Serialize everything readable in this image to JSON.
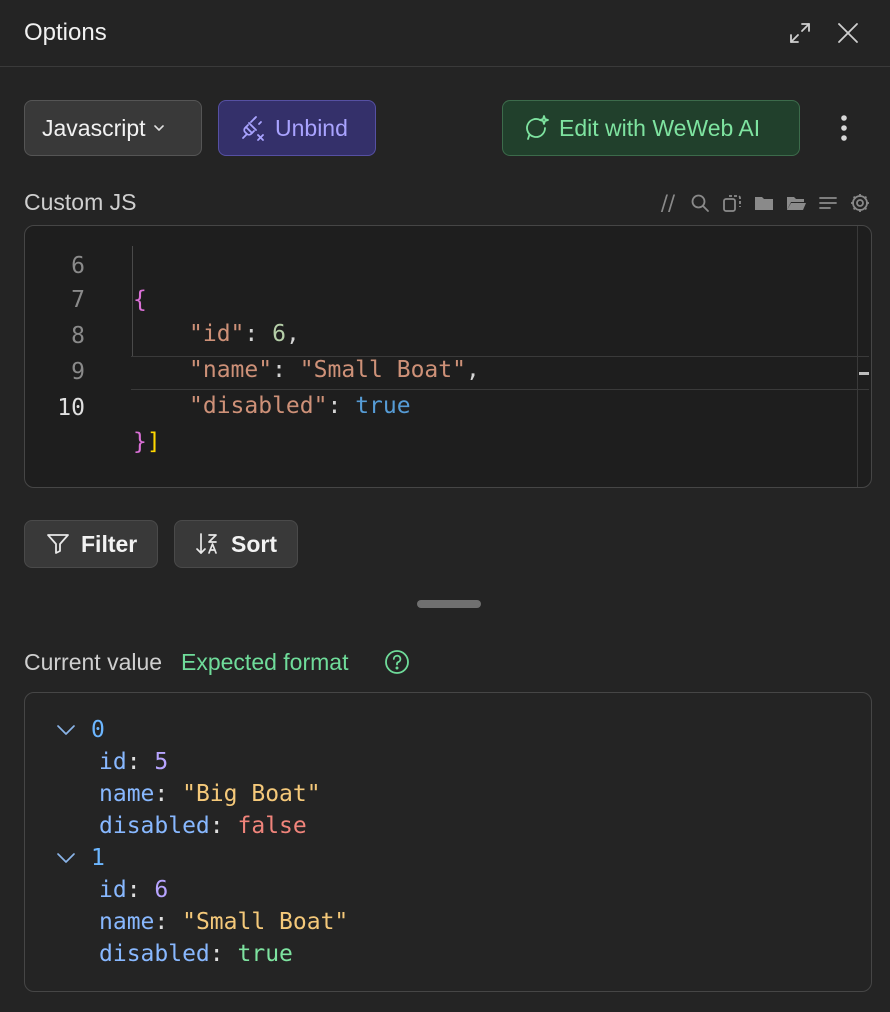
{
  "header": {
    "title": "Options",
    "icons": [
      "expand-icon",
      "close-icon"
    ]
  },
  "toolbar": {
    "language": "Javascript",
    "unbind_label": "Unbind",
    "ai_label": "Edit with WeWeb AI"
  },
  "custom_js": {
    "label": "Custom JS",
    "tools": [
      "comment-icon",
      "search-icon",
      "copy-icon",
      "folder-icon",
      "folder-open-icon",
      "format-icon",
      "settings-icon"
    ],
    "lines": [
      {
        "num": "6",
        "text": "{"
      },
      {
        "num": "7",
        "key": "\"id\"",
        "sep": ": ",
        "value": "6",
        "tail": ","
      },
      {
        "num": "8",
        "key": "\"name\"",
        "sep": ": ",
        "value": "\"Small Boat\"",
        "tail": ","
      },
      {
        "num": "9",
        "key": "\"disabled\"",
        "sep": ": ",
        "value": "true",
        "tail": ""
      },
      {
        "num": "10",
        "open": "}",
        "close": "]"
      }
    ]
  },
  "actions": {
    "filter_label": "Filter",
    "sort_label": "Sort"
  },
  "current_value": {
    "label": "Current value",
    "expected_label": "Expected format",
    "items": [
      {
        "index": "0",
        "id": "5",
        "name": "\"Big Boat\"",
        "disabled": "false"
      },
      {
        "index": "1",
        "id": "6",
        "name": "\"Small Boat\"",
        "disabled": "true"
      }
    ],
    "keys": {
      "id": "id",
      "name": "name",
      "disabled": "disabled",
      "colon": ":"
    }
  }
}
